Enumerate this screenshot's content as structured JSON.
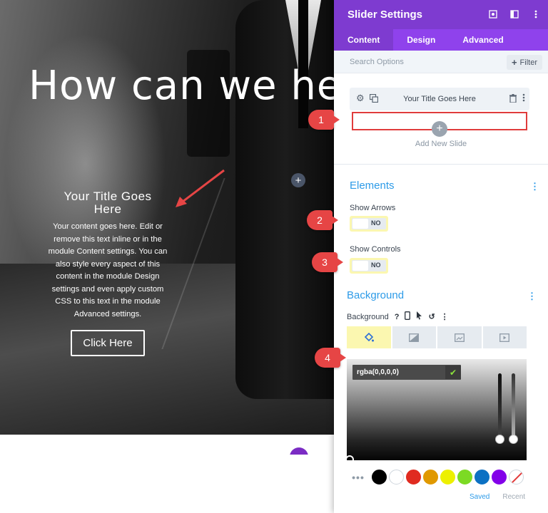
{
  "hero": {
    "heading": "How can we he",
    "slide_title": "Your Title Goes Here",
    "slide_body": "Your content goes here. Edit or remove this text inline or in the module Content settings. You can also style every aspect of this content in the module Design settings and even apply custom CSS to this text in the module Advanced settings.",
    "button_label": "Click Here",
    "plus_glyph": "+"
  },
  "panel": {
    "title": "Slider Settings",
    "header_icons": [
      "focus-icon",
      "split-view-icon",
      "more-vertical-icon"
    ],
    "tabs": [
      {
        "label": "Content",
        "active": true
      },
      {
        "label": "Design",
        "active": false
      },
      {
        "label": "Advanced",
        "active": false
      }
    ],
    "search": {
      "placeholder": "Search Options"
    },
    "filter": {
      "label": "Filter",
      "icon": "+"
    },
    "slides": {
      "items": [
        {
          "label": "Your Title Goes Here"
        }
      ],
      "add_label": "Add New Slide"
    },
    "elements": {
      "title": "Elements",
      "show_arrows": {
        "label": "Show Arrows",
        "value": "NO"
      },
      "show_controls": {
        "label": "Show Controls",
        "value": "NO"
      }
    },
    "background": {
      "title": "Background",
      "field_label": "Background",
      "tab_icons": [
        "paint-bucket-icon",
        "gradient-icon",
        "image-icon",
        "video-icon"
      ],
      "active_tab": "paint-bucket-icon",
      "color_value": "rgba(0,0,0,0)",
      "swatches": [
        "#000000",
        "#ffffff",
        "#e02b20",
        "#e09900",
        "#edf000",
        "#7cda24",
        "#0c71c3",
        "#8300e9"
      ],
      "saved_label": "Saved",
      "recent_label": "Recent"
    }
  },
  "markers": [
    "1",
    "2",
    "3",
    "4"
  ],
  "colors": {
    "header_purple": "#7e3bd0",
    "tab_purple": "#8f42ec",
    "accent_blue": "#2d9be8",
    "marker_red": "#e64545",
    "highlight_yellow": "#fbf7b0"
  }
}
